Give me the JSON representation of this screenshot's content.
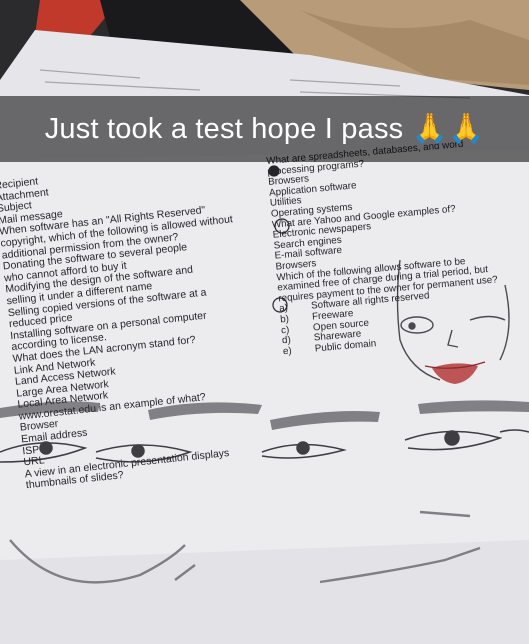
{
  "caption": {
    "text": "Just took a test hope I pass",
    "emoji": "🙏🙏"
  },
  "left_sheet": [
    "Recipient",
    "Attachment",
    "Subject",
    "Mail message",
    "When software has an \"All Rights Reserved\"",
    "copyright, which of the following is allowed without",
    "additional permission from the owner?",
    "Donating the software to several people",
    "who cannot afford to buy it",
    "Modifying the design of the software and",
    "selling it under a different name",
    "Selling copied versions of the software at a",
    "reduced price",
    "Installing software on a personal computer",
    "according to license.",
    "What does the LAN acronym stand for?",
    "Link And Network",
    "Land Access Network",
    "Large Area Network",
    "Local Area Network",
    "www.orestat.edu is an example of what?",
    "Browser",
    "Email address",
    "ISP",
    "URL",
    "A view in an electronic presentation displays",
    "thumbnails of slides?"
  ],
  "right_sheet": [
    "What are spreadsheets, databases, and word",
    "processing programs?",
    "Browsers",
    "Application software",
    "Utilities",
    "Operating systems",
    "What are Yahoo and Google examples of?",
    "Electronic newspapers",
    "Search engines",
    "E-mail software",
    "Browsers",
    "Which of the following allows software to be",
    "examined free of charge during a trial period, but",
    "requires payment to the owner for permanent use?",
    "Software all rights reserved",
    "Freeware",
    "Open source",
    "Shareware",
    "Public domain"
  ],
  "right_option_letters": [
    "a)",
    "b)",
    "c)",
    "d)",
    "e)"
  ],
  "colors": {
    "paper": "#ecebee",
    "ink": "#26262a",
    "pencil": "#5a5a5e",
    "lips": "#b53a3a",
    "bar": "rgba(0,0,0,0.55)"
  }
}
